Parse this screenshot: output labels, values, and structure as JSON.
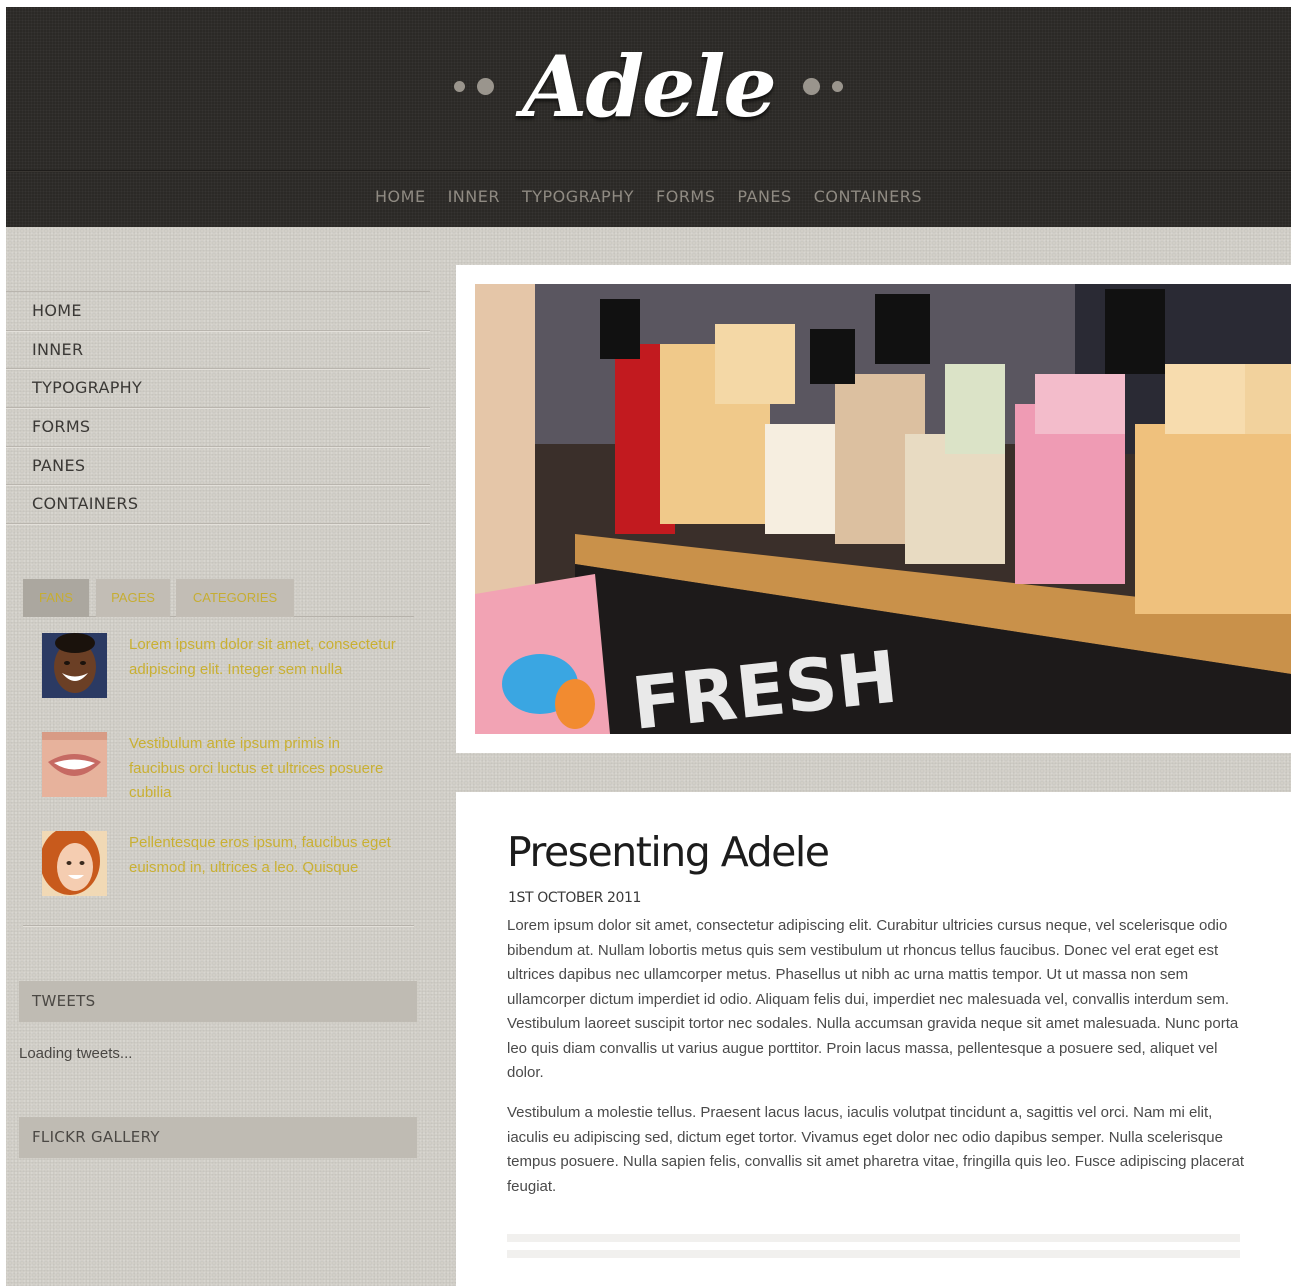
{
  "header": {
    "logo": "Adele",
    "nav": [
      "HOME",
      "INNER",
      "TYPOGRAPHY",
      "FORMS",
      "PANES",
      "CONTAINERS"
    ]
  },
  "sidebar": {
    "menu": [
      "HOME",
      "INNER",
      "TYPOGRAPHY",
      "FORMS",
      "PANES",
      "CONTAINERS"
    ],
    "tabs": [
      "FANS",
      "PAGES",
      "CATEGORIES"
    ],
    "active_tab": "FANS",
    "fans": [
      {
        "text": "Lorem ipsum dolor sit amet, consectetur adipiscing elit. Integer sem nulla",
        "avatar": "laughing-man-avatar"
      },
      {
        "text": "Vestibulum ante ipsum primis in faucibus orci luctus et ultrices posuere cubilia",
        "avatar": "smiling-mouth-avatar"
      },
      {
        "text": "Pellentesque eros ipsum, faucibus eget euismod in, ultrices a leo. Quisque",
        "avatar": "red-haired-woman-avatar"
      }
    ],
    "tweets_title": "TWEETS",
    "tweets_status": "Loading tweets...",
    "flickr_title": "FLICKR GALLERY"
  },
  "main": {
    "hero_image": "soap-shop-display-photo",
    "hero_sign": "FRESH",
    "article": {
      "title": "Presenting Adele",
      "date": "1ST OCTOBER 2011",
      "paragraphs": [
        "Lorem ipsum dolor sit amet, consectetur adipiscing elit. Curabitur ultricies cursus neque, vel scelerisque odio bibendum at. Nullam lobortis metus quis sem vestibulum ut rhoncus tellus faucibus. Donec vel erat eget est ultrices dapibus nec ullamcorper metus. Phasellus ut nibh ac urna mattis tempor. Ut ut massa non sem ullamcorper dictum imperdiet id odio. Aliquam felis dui, imperdiet nec malesuada vel, convallis interdum sem. Vestibulum laoreet suscipit tortor nec sodales. Nulla accumsan gravida neque sit amet malesuada. Nunc porta leo quis diam convallis ut varius augue porttitor. Proin lacus massa, pellentesque a posuere sed, aliquet vel dolor.",
        "Vestibulum a molestie tellus. Praesent lacus lacus, iaculis volutpat tincidunt a, sagittis vel orci. Nam mi elit, iaculis eu adipiscing sed, dictum eget tortor. Vivamus eget dolor nec odio dapibus semper. Nulla scelerisque tempus posuere. Nulla sapien felis, convallis sit amet pharetra vitae, fringilla quis leo. Fusce adipiscing placerat feugiat."
      ]
    }
  },
  "colors": {
    "header_bg": "#2b2926",
    "page_bg": "#d2cfc8",
    "accent_gold": "#c9b033",
    "nav_text": "#8f8a82"
  }
}
